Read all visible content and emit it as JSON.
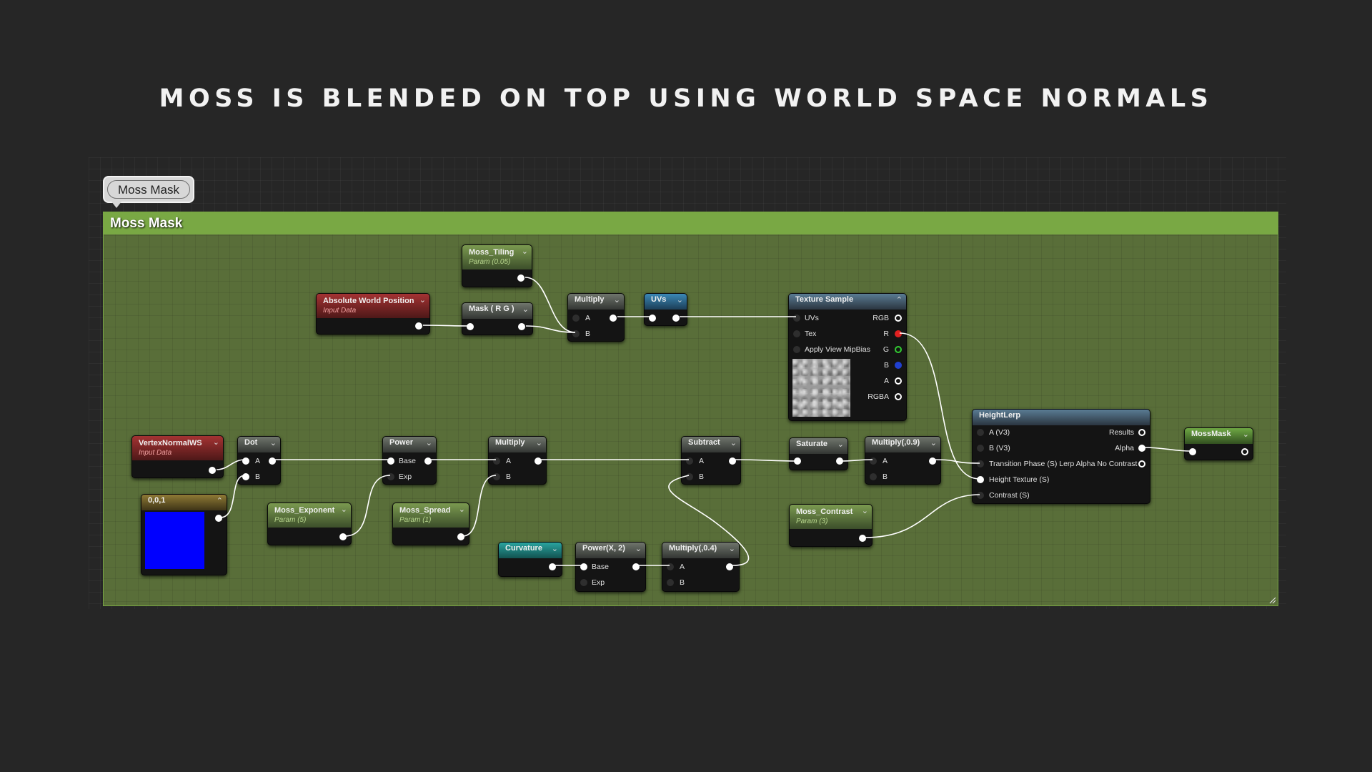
{
  "title": "MOSS IS BLENDED ON TOP USING WORLD SPACE NORMALS",
  "comment": {
    "bubble_label": "Moss Mask",
    "header_label": "Moss Mask",
    "color": "#79a844"
  },
  "colors": {
    "comment_bg": "#596e39",
    "wire": "#ffffff",
    "param_header": "#7b9a50",
    "input_header": "#a43333",
    "math_header": "#6f756c",
    "texture_header": "#3b88b6",
    "constant_header": "#8f7a35",
    "curvature_header": "#2aa4a0",
    "output_header": "#6ea844"
  },
  "nodes": {
    "moss_tiling": {
      "title": "Moss_Tiling",
      "sub": "Param (0.05)"
    },
    "abs_world_pos": {
      "title": "Absolute World Position",
      "sub": "Input Data"
    },
    "mask_rg": {
      "title": "Mask ( R G )"
    },
    "multiply_uv": {
      "title": "Multiply",
      "a": "A",
      "b": "B"
    },
    "uvs": {
      "title": "UVs"
    },
    "texture_sample": {
      "title": "Texture Sample",
      "in_uvs": "UVs",
      "in_tex": "Tex",
      "in_mip": "Apply View MipBias",
      "out_rgb": "RGB",
      "out_r": "R",
      "out_g": "G",
      "out_b": "B",
      "out_a": "A",
      "out_rgba": "RGBA",
      "thumbnail": "moss-noise-texture"
    },
    "vertex_normal": {
      "title": "VertexNormalWS",
      "sub": "Input Data"
    },
    "dot": {
      "title": "Dot",
      "a": "A",
      "b": "B"
    },
    "const_001": {
      "title": "0,0,1",
      "swatch": "#0000ff"
    },
    "power": {
      "title": "Power",
      "base": "Base",
      "exp": "Exp"
    },
    "moss_exponent": {
      "title": "Moss_Exponent",
      "sub": "Param (5)"
    },
    "moss_spread": {
      "title": "Moss_Spread",
      "sub": "Param (1)"
    },
    "multiply_mid": {
      "title": "Multiply",
      "a": "A",
      "b": "B"
    },
    "subtract": {
      "title": "Subtract",
      "a": "A",
      "b": "B"
    },
    "saturate": {
      "title": "Saturate"
    },
    "multiply_09": {
      "title": "Multiply(,0.9)",
      "a": "A",
      "b": "B"
    },
    "moss_contrast": {
      "title": "Moss_Contrast",
      "sub": "Param (3)"
    },
    "heightlerp": {
      "title": "HeightLerp",
      "in_a": "A (V3)",
      "in_b": "B (V3)",
      "in_tp": "Transition Phase (S) Lerp Alpha No Contrast",
      "in_ht": "Height Texture (S)",
      "in_ct": "Contrast (S)",
      "out_results": "Results",
      "out_alpha": "Alpha"
    },
    "mossmask": {
      "title": "MossMask"
    },
    "curvature": {
      "title": "Curvature"
    },
    "powerx2": {
      "title": "Power(X, 2)",
      "base": "Base",
      "exp": "Exp"
    },
    "multiply_04": {
      "title": "Multiply(,0.4)",
      "a": "A",
      "b": "B"
    }
  }
}
